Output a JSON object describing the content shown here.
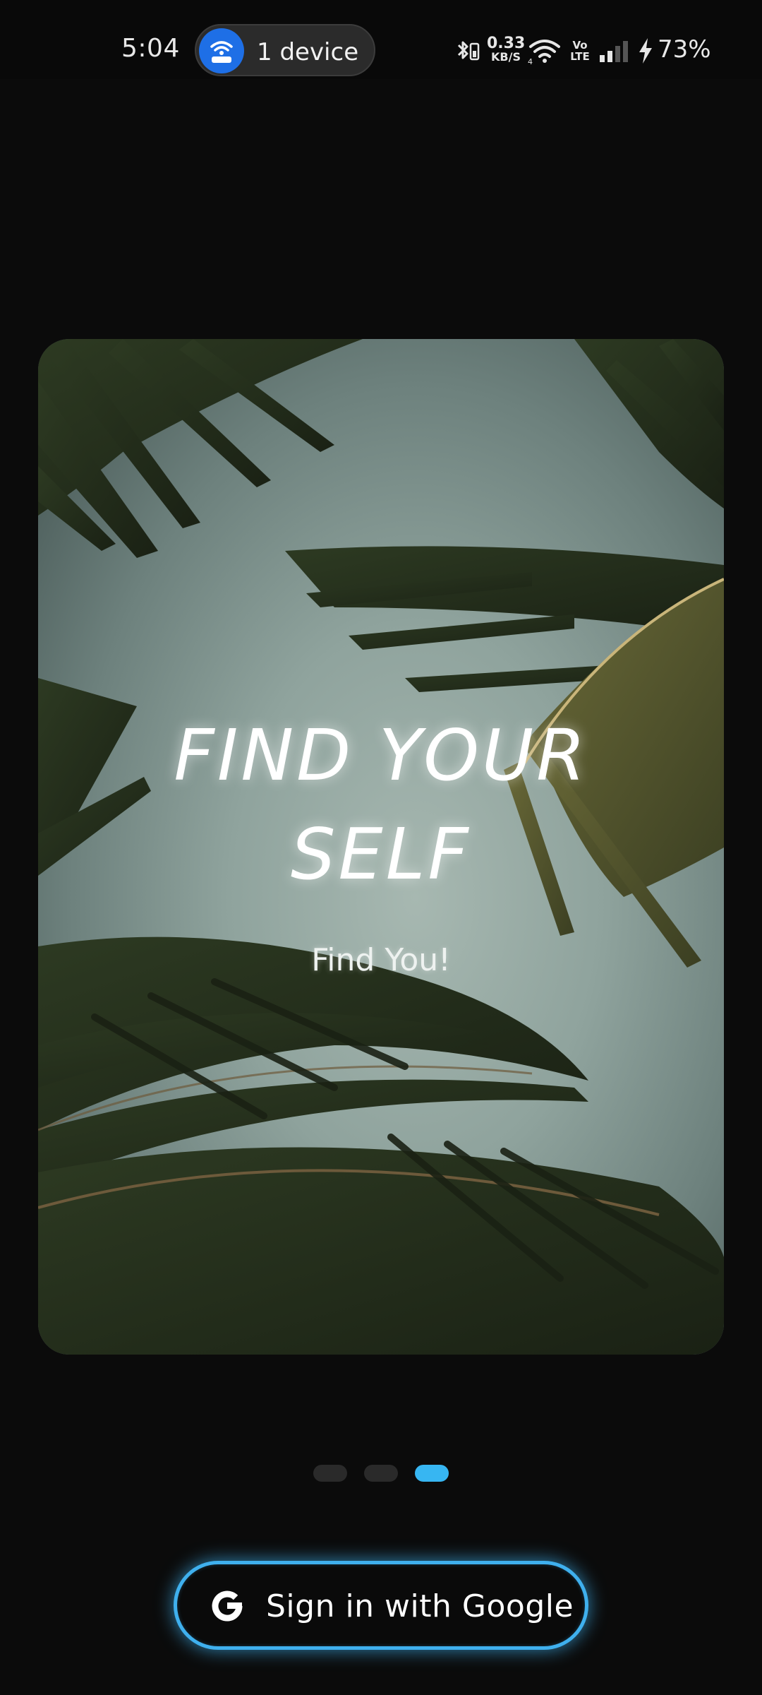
{
  "status_bar": {
    "time": "5:04",
    "hotspot_label": "1 device",
    "net_speed_value": "0.33",
    "net_speed_unit": "KB/S",
    "volte": "Vo LTE",
    "battery": "73%",
    "accent": "#1e6fe6"
  },
  "onboarding": {
    "headline_line1": "FIND YOUR",
    "headline_line2": "SELF",
    "subtitle": "Find You!",
    "page_indicator": {
      "total": 3,
      "current": 3,
      "active_color": "#37b6f2"
    }
  },
  "auth": {
    "google_button_label": "Sign in with Google",
    "button_glow_color": "#3fb0ee"
  }
}
